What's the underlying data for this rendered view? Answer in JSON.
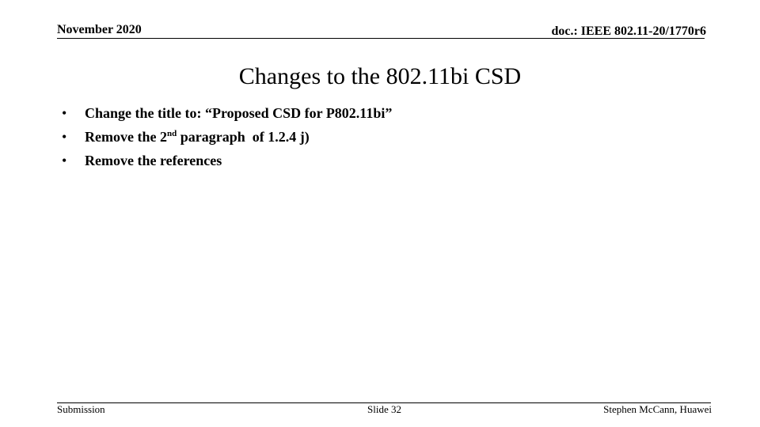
{
  "header": {
    "date": "November 2020",
    "doc_id": "doc.: IEEE 802.11-20/1770r6"
  },
  "slide": {
    "title": "Changes to the 802.11bi CSD",
    "bullets": [
      {
        "text": "Change the title to: “Proposed CSD for P802.11bi”"
      },
      {
        "pre": "Remove the 2",
        "sup": "nd",
        "post": " paragraph  of 1.2.4 j)"
      },
      {
        "text": "Remove the references"
      }
    ],
    "bullet_glyph": "•"
  },
  "footer": {
    "left": "Submission",
    "center": "Slide 32",
    "right": "Stephen McCann, Huawei"
  }
}
